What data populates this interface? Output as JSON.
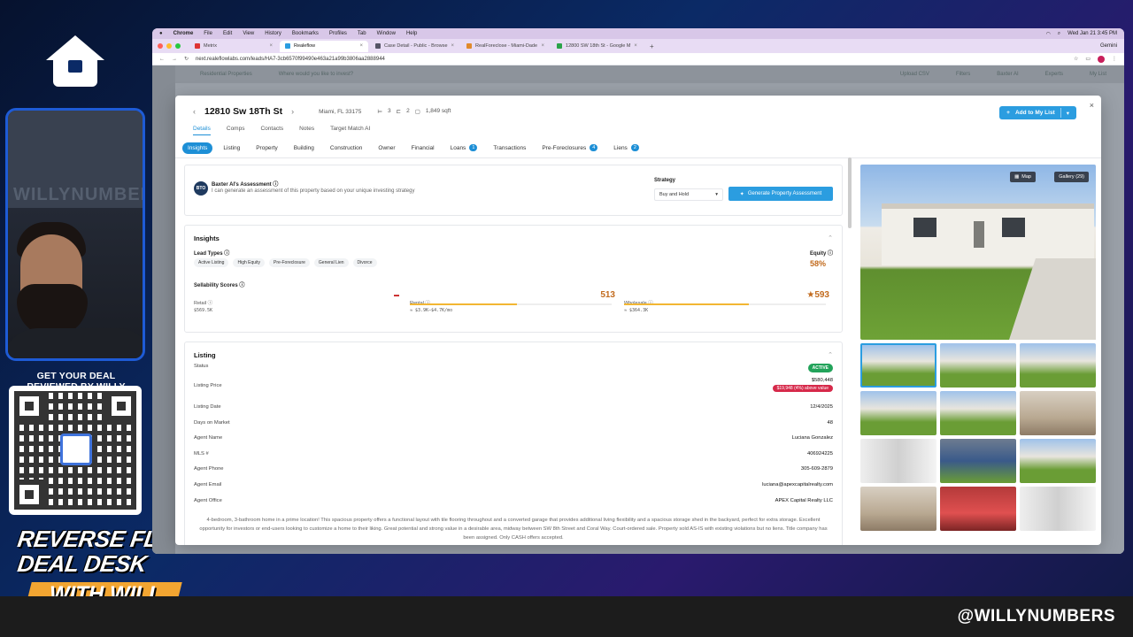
{
  "overlay": {
    "qr_title": "GET YOUR DEAL REVIEWED BY WILLY",
    "show_line1": "REVERSE FLIP",
    "show_line2": "DEAL DESK",
    "show_line3": "WITH WILL",
    "handle": "@WILLYNUMBERS",
    "webcam_wall_text": "WILLYNUMBERS"
  },
  "mac_menu": {
    "app": "Chrome",
    "items": [
      "File",
      "Edit",
      "View",
      "History",
      "Bookmarks",
      "Profiles",
      "Tab",
      "Window",
      "Help"
    ],
    "clock": "Wed Jan 21  3:45 PM"
  },
  "browser": {
    "tabs": [
      {
        "label": "Metrix",
        "active": false
      },
      {
        "label": "Realeflow",
        "active": true
      },
      {
        "label": "Case Detail - Public - Browse",
        "active": false
      },
      {
        "label": "RealForeclose - Miami-Dade",
        "active": false
      },
      {
        "label": "12800 SW 18th St - Google M",
        "active": false
      }
    ],
    "new_tab": "+",
    "gemini": "Gemini",
    "url": "next.realeflowlabs.com/leads/HA7-3cb6570f99490e463a21a99b3806aa2888944"
  },
  "app_behind": {
    "left_label": "Residential Properties",
    "search_placeholder": "Where would you like to invest?",
    "upload": "Upload CSV",
    "filters": "Filters",
    "baxter": "Baxter AI",
    "experts": "Experts",
    "my_list": "My List"
  },
  "modal": {
    "address": "12810 Sw 18Th St",
    "city": "Miami, FL 33175",
    "beds": "3",
    "baths": "2",
    "sqft": "1,849 sqft",
    "add_to_list": "Add to My List",
    "close": "×",
    "main_tabs": [
      "Details",
      "Comps",
      "Contacts",
      "Notes",
      "Target Match AI"
    ],
    "sub_tabs": [
      {
        "label": "Insights",
        "badge": null
      },
      {
        "label": "Listing",
        "badge": null
      },
      {
        "label": "Property",
        "badge": null
      },
      {
        "label": "Building",
        "badge": null
      },
      {
        "label": "Construction",
        "badge": null
      },
      {
        "label": "Owner",
        "badge": null
      },
      {
        "label": "Financial",
        "badge": null
      },
      {
        "label": "Loans",
        "badge": "1"
      },
      {
        "label": "Transactions",
        "badge": null
      },
      {
        "label": "Pre-Foreclosures",
        "badge": "4"
      },
      {
        "label": "Liens",
        "badge": "2"
      }
    ]
  },
  "baxter_card": {
    "icon_text": "BTO",
    "title": "Baxter AI's Assessment",
    "subtitle": "I can generate an assessment of this property based on your unique investing strategy",
    "strategy_label": "Strategy",
    "strategy_value": "Buy and Hold",
    "generate_label": "Generate Property Assessment"
  },
  "insights": {
    "title": "Insights",
    "lead_types_label": "Lead Types",
    "lead_types": [
      "Active Listing",
      "High Equity",
      "Pre-Foreclosure",
      "General Lien",
      "Divorce"
    ],
    "equity_label": "Equity",
    "equity_value": "58%",
    "sellability_label": "Sellability Scores",
    "scores": [
      {
        "name": "Retail",
        "score": "",
        "range": "$569.5K",
        "fill": 0
      },
      {
        "name": "Rental",
        "score": "513",
        "range": "≈ $3.9K–$4.7K/mo",
        "fill": 0.53
      },
      {
        "name": "Wholesale",
        "score": "593",
        "range": "≈ $364.3K",
        "fill": 0.62
      }
    ]
  },
  "listing": {
    "title": "Listing",
    "status_label": "Status",
    "status_value": "ACTIVE",
    "price_label": "Listing Price",
    "price_value": "$580,448",
    "price_above": "$19,948 (4%) above value",
    "rows": [
      {
        "label": "Listing Date",
        "value": "12/4/2025"
      },
      {
        "label": "Days on Market",
        "value": "48"
      },
      {
        "label": "Agent Name",
        "value": "Luciana Gonzalez"
      },
      {
        "label": "MLS #",
        "value": "406924225"
      },
      {
        "label": "Agent Phone",
        "value": "305-609-2879"
      },
      {
        "label": "Agent Email",
        "value": "luciana@apexcapitalrealty.com"
      },
      {
        "label": "Agent Office",
        "value": "APEX Capital Realty LLC"
      }
    ],
    "description": "4-bedroom, 3-bathroom home in a prime location! This spacious property offers a functional layout with tile flooring throughout and a converted garage that provides additional living flexibility and a spacious storage shed in the backyard, perfect for extra storage. Excellent opportunity for investors or end-users looking to customize a home to their liking. Great potential and strong value in a desirable area, midway between SW 8th Street and Coral Way. Court-ordered sale. Property sold AS-IS with existing violations but no liens. Title company has been assigned. Only CASH offers accepted."
  },
  "gallery": {
    "map_label": "Map",
    "gallery_label": "Gallery (29)"
  },
  "colors": {
    "accent": "#2b9de0",
    "equity": "#c26b1e",
    "status_active": "#22a35a",
    "above_value": "#d6294a"
  }
}
